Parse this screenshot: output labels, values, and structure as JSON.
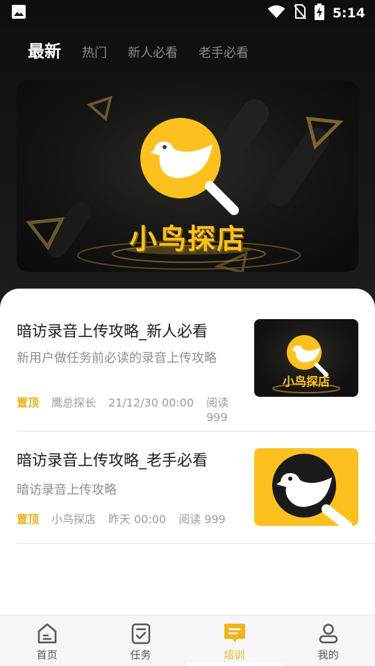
{
  "status_bar": {
    "time": "5:14",
    "icons": [
      "image-icon",
      "wifi-icon",
      "no-sim-icon",
      "battery-charging-icon"
    ]
  },
  "tabs": [
    {
      "label": "最新",
      "active": true
    },
    {
      "label": "热门",
      "active": false
    },
    {
      "label": "新人必看",
      "active": false
    },
    {
      "label": "老手必看",
      "active": false
    }
  ],
  "banner": {
    "logo_text": "小鸟探店",
    "icon": "bird-magnifier-logo"
  },
  "articles": [
    {
      "title": "暗访录音上传攻略_新人必看",
      "description": "新用户做任务前必读的录音上传攻略",
      "pin_label": "置顶",
      "author": "鹰总探长",
      "time": "21/12/30 00:00",
      "read_label": "阅读 999",
      "thumbnail_text": "小鸟探店"
    },
    {
      "title": "暗访录音上传攻略_老手必看",
      "description": "暗访录音上传攻略",
      "pin_label": "置顶",
      "author": "小鸟探店",
      "time": "昨天 00:00",
      "read_label": "阅读 999"
    }
  ],
  "bottom_nav": [
    {
      "label": "首页",
      "icon": "home-icon",
      "active": false
    },
    {
      "label": "任务",
      "icon": "task-icon",
      "active": false
    },
    {
      "label": "培训",
      "icon": "training-icon",
      "active": true
    },
    {
      "label": "我的",
      "icon": "profile-icon",
      "active": false
    }
  ],
  "colors": {
    "accent": "#efb41a",
    "logo_yellow": "#fdc11f",
    "dark_bg": "#161616"
  }
}
